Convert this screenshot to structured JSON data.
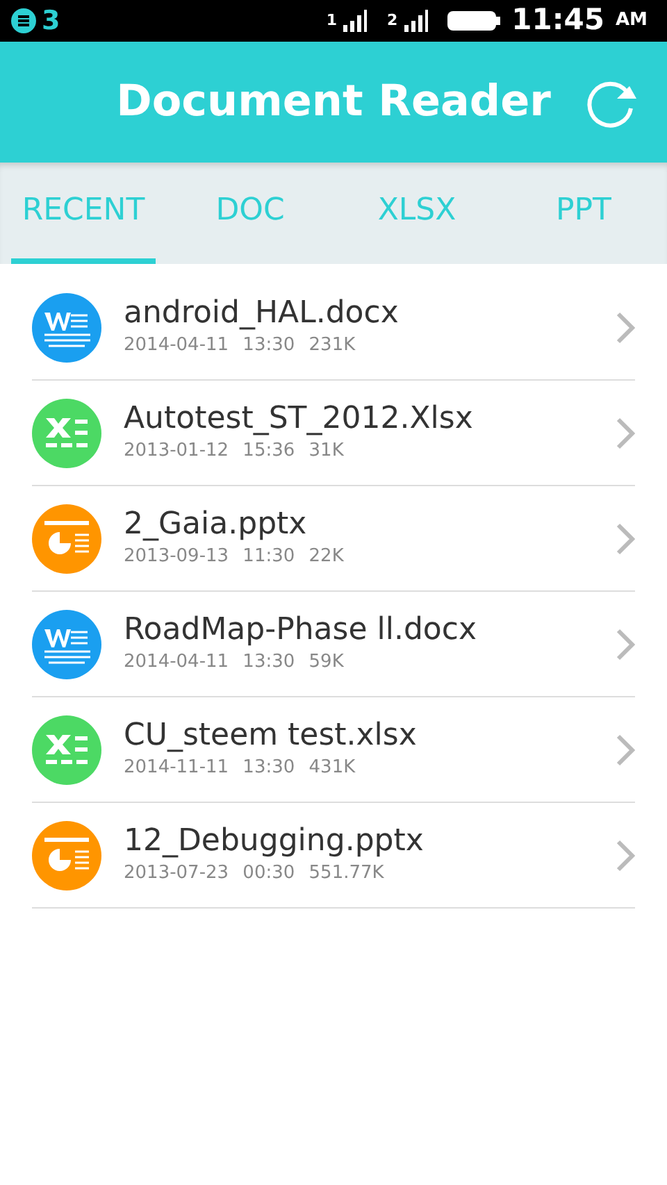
{
  "status_bar": {
    "notification_count": "3",
    "sims": [
      {
        "label": "1"
      },
      {
        "label": "2"
      }
    ],
    "time": "11:45",
    "meridiem": "AM"
  },
  "header": {
    "title": "Document Reader"
  },
  "tabs": [
    {
      "label": "RECENT",
      "selected": true
    },
    {
      "label": "DOC",
      "selected": false
    },
    {
      "label": "XLSX",
      "selected": false
    },
    {
      "label": "PPT",
      "selected": false
    }
  ],
  "files": [
    {
      "kind": "doc",
      "name": "android_HAL.docx",
      "date": "2014-04-11",
      "time": "13:30",
      "size": "231K"
    },
    {
      "kind": "xlsx",
      "name": "Autotest_ST_2012.Xlsx",
      "date": "2013-01-12",
      "time": "15:36",
      "size": "31K"
    },
    {
      "kind": "ppt",
      "name": "2_Gaia.pptx",
      "date": "2013-09-13",
      "time": "11:30",
      "size": "22K"
    },
    {
      "kind": "doc",
      "name": "RoadMap-Phase ll.docx",
      "date": "2014-04-11",
      "time": "13:30",
      "size": "59K"
    },
    {
      "kind": "xlsx",
      "name": "CU_steem test.xlsx",
      "date": "2014-11-11",
      "time": "13:30",
      "size": "431K"
    },
    {
      "kind": "ppt",
      "name": "12_Debugging.pptx",
      "date": "2013-07-23",
      "time": "00:30",
      "size": "551.77K"
    }
  ]
}
